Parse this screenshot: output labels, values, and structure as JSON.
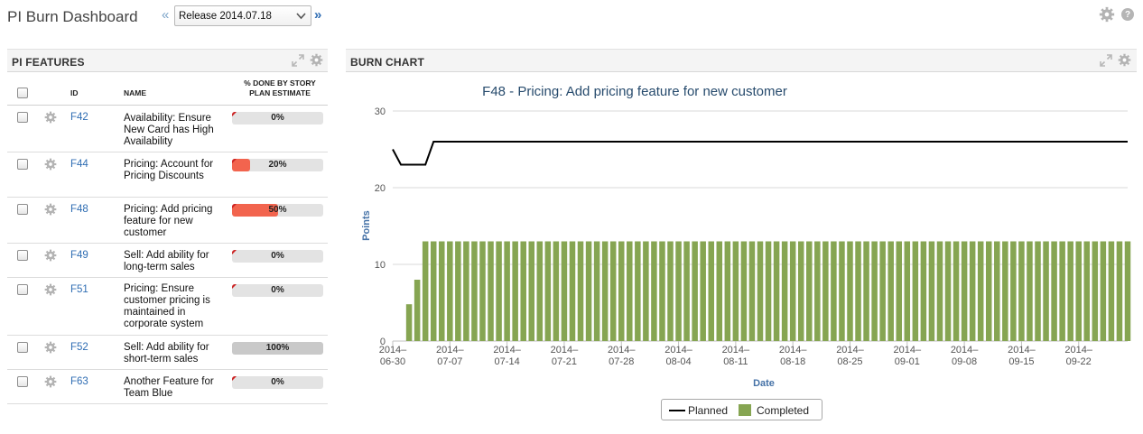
{
  "header": {
    "title": "PI Burn Dashboard",
    "release_selected": "Release 2014.07.18",
    "prev_glyph": "«",
    "next_glyph": "»",
    "help_glyph": "?"
  },
  "features_panel": {
    "title": "PI FEATURES",
    "columns": {
      "id": "ID",
      "name": "NAME",
      "pct_line1": "% DONE BY STORY",
      "pct_line2": "PLAN ESTIMATE"
    },
    "rows": [
      {
        "id": "F42",
        "name": "Availability: Ensure New Card has High Availability",
        "pct": 0,
        "pct_label": "0%"
      },
      {
        "id": "F44",
        "name": "Pricing: Account for Pricing Discounts",
        "pct": 20,
        "pct_label": "20%"
      },
      {
        "id": "F48",
        "name": "Pricing: Add pricing feature for new customer",
        "pct": 50,
        "pct_label": "50%"
      },
      {
        "id": "F49",
        "name": "Sell: Add ability for long-term sales",
        "pct": 0,
        "pct_label": "0%"
      },
      {
        "id": "F51",
        "name": "Pricing: Ensure customer pricing is maintained in corporate system",
        "pct": 0,
        "pct_label": "0%"
      },
      {
        "id": "F52",
        "name": "Sell: Add ability for short-term sales",
        "pct": 100,
        "pct_label": "100%"
      },
      {
        "id": "F63",
        "name": "Another Feature for Team Blue",
        "pct": 0,
        "pct_label": "0%"
      }
    ]
  },
  "burn_panel": {
    "title": "BURN CHART"
  },
  "colors": {
    "progress_active": "#f2644e",
    "progress_complete": "#c9c9c9",
    "completed_bar": "#86a552",
    "planned_line": "#000000",
    "chart_title": "#274b6d",
    "link": "#2f6db3"
  },
  "icons": {
    "settings": "gear-icon",
    "expand": "expand-icon",
    "help": "help-icon",
    "dropdown": "chevron-down-icon"
  },
  "chart_data": {
    "type": "bar",
    "title": "F48 - Pricing: Add pricing feature for new customer",
    "xlabel": "Date",
    "ylabel": "Points",
    "ylim": [
      0,
      30
    ],
    "yticks": [
      0,
      10,
      20,
      30
    ],
    "xticks": [
      "2014-06-30",
      "2014-07-07",
      "2014-07-14",
      "2014-07-21",
      "2014-07-28",
      "2014-08-04",
      "2014-08-11",
      "2014-08-18",
      "2014-08-25",
      "2014-09-01",
      "2014-09-08",
      "2014-09-15",
      "2014-09-22"
    ],
    "date_range": [
      "2014-06-30",
      "2014-09-28"
    ],
    "grid": true,
    "legend": "bottom-center",
    "series": [
      {
        "name": "Planned",
        "type": "line",
        "points": [
          [
            "2014-06-30",
            25
          ],
          [
            "2014-07-01",
            23
          ],
          [
            "2014-07-02",
            23
          ],
          [
            "2014-07-03",
            23
          ],
          [
            "2014-07-04",
            23
          ],
          [
            "2014-07-05",
            26
          ],
          [
            "2014-09-28",
            26
          ]
        ]
      },
      {
        "name": "Completed",
        "type": "bar",
        "points": [
          [
            "2014-06-30",
            0
          ],
          [
            "2014-07-01",
            0
          ],
          [
            "2014-07-02",
            4.8
          ],
          [
            "2014-07-03",
            8
          ],
          [
            "2014-07-04",
            13
          ],
          [
            "2014-07-05",
            13
          ],
          [
            "2014-07-06",
            13
          ],
          [
            "2014-07-07",
            13
          ],
          [
            "2014-07-08",
            13
          ],
          [
            "2014-07-09",
            13
          ],
          [
            "2014-07-10",
            13
          ],
          [
            "2014-07-11",
            13
          ],
          [
            "2014-07-12",
            13
          ],
          [
            "2014-07-13",
            13
          ],
          [
            "2014-07-14",
            13
          ],
          [
            "2014-07-15",
            13
          ],
          [
            "2014-07-16",
            13
          ],
          [
            "2014-07-17",
            13
          ],
          [
            "2014-07-18",
            13
          ],
          [
            "2014-07-19",
            13
          ],
          [
            "2014-07-20",
            13
          ],
          [
            "2014-07-21",
            13
          ],
          [
            "2014-07-22",
            13
          ],
          [
            "2014-07-23",
            13
          ],
          [
            "2014-07-24",
            13
          ],
          [
            "2014-07-25",
            13
          ],
          [
            "2014-07-26",
            13
          ],
          [
            "2014-07-27",
            13
          ],
          [
            "2014-07-28",
            13
          ],
          [
            "2014-07-29",
            13
          ],
          [
            "2014-07-30",
            13
          ],
          [
            "2014-07-31",
            13
          ],
          [
            "2014-08-01",
            13
          ],
          [
            "2014-08-02",
            13
          ],
          [
            "2014-08-03",
            13
          ],
          [
            "2014-08-04",
            13
          ],
          [
            "2014-08-05",
            13
          ],
          [
            "2014-08-06",
            13
          ],
          [
            "2014-08-07",
            13
          ],
          [
            "2014-08-08",
            13
          ],
          [
            "2014-08-09",
            13
          ],
          [
            "2014-08-10",
            13
          ],
          [
            "2014-08-11",
            13
          ],
          [
            "2014-08-12",
            13
          ],
          [
            "2014-08-13",
            13
          ],
          [
            "2014-08-14",
            13
          ],
          [
            "2014-08-15",
            13
          ],
          [
            "2014-08-16",
            13
          ],
          [
            "2014-08-17",
            13
          ],
          [
            "2014-08-18",
            13
          ],
          [
            "2014-08-19",
            13
          ],
          [
            "2014-08-20",
            13
          ],
          [
            "2014-08-21",
            13
          ],
          [
            "2014-08-22",
            13
          ],
          [
            "2014-08-23",
            13
          ],
          [
            "2014-08-24",
            13
          ],
          [
            "2014-08-25",
            13
          ],
          [
            "2014-08-26",
            13
          ],
          [
            "2014-08-27",
            13
          ],
          [
            "2014-08-28",
            13
          ],
          [
            "2014-08-29",
            13
          ],
          [
            "2014-08-30",
            13
          ],
          [
            "2014-08-31",
            13
          ],
          [
            "2014-09-01",
            13
          ],
          [
            "2014-09-02",
            13
          ],
          [
            "2014-09-03",
            13
          ],
          [
            "2014-09-04",
            13
          ],
          [
            "2014-09-05",
            13
          ],
          [
            "2014-09-06",
            13
          ],
          [
            "2014-09-07",
            13
          ],
          [
            "2014-09-08",
            13
          ],
          [
            "2014-09-09",
            13
          ],
          [
            "2014-09-10",
            13
          ],
          [
            "2014-09-11",
            13
          ],
          [
            "2014-09-12",
            13
          ],
          [
            "2014-09-13",
            13
          ],
          [
            "2014-09-14",
            13
          ],
          [
            "2014-09-15",
            13
          ],
          [
            "2014-09-16",
            13
          ],
          [
            "2014-09-17",
            13
          ],
          [
            "2014-09-18",
            13
          ],
          [
            "2014-09-19",
            13
          ],
          [
            "2014-09-20",
            13
          ],
          [
            "2014-09-21",
            13
          ],
          [
            "2014-09-22",
            13
          ],
          [
            "2014-09-23",
            13
          ],
          [
            "2014-09-24",
            13
          ],
          [
            "2014-09-25",
            13
          ],
          [
            "2014-09-26",
            13
          ],
          [
            "2014-09-27",
            13
          ],
          [
            "2014-09-28",
            13
          ]
        ]
      }
    ]
  }
}
